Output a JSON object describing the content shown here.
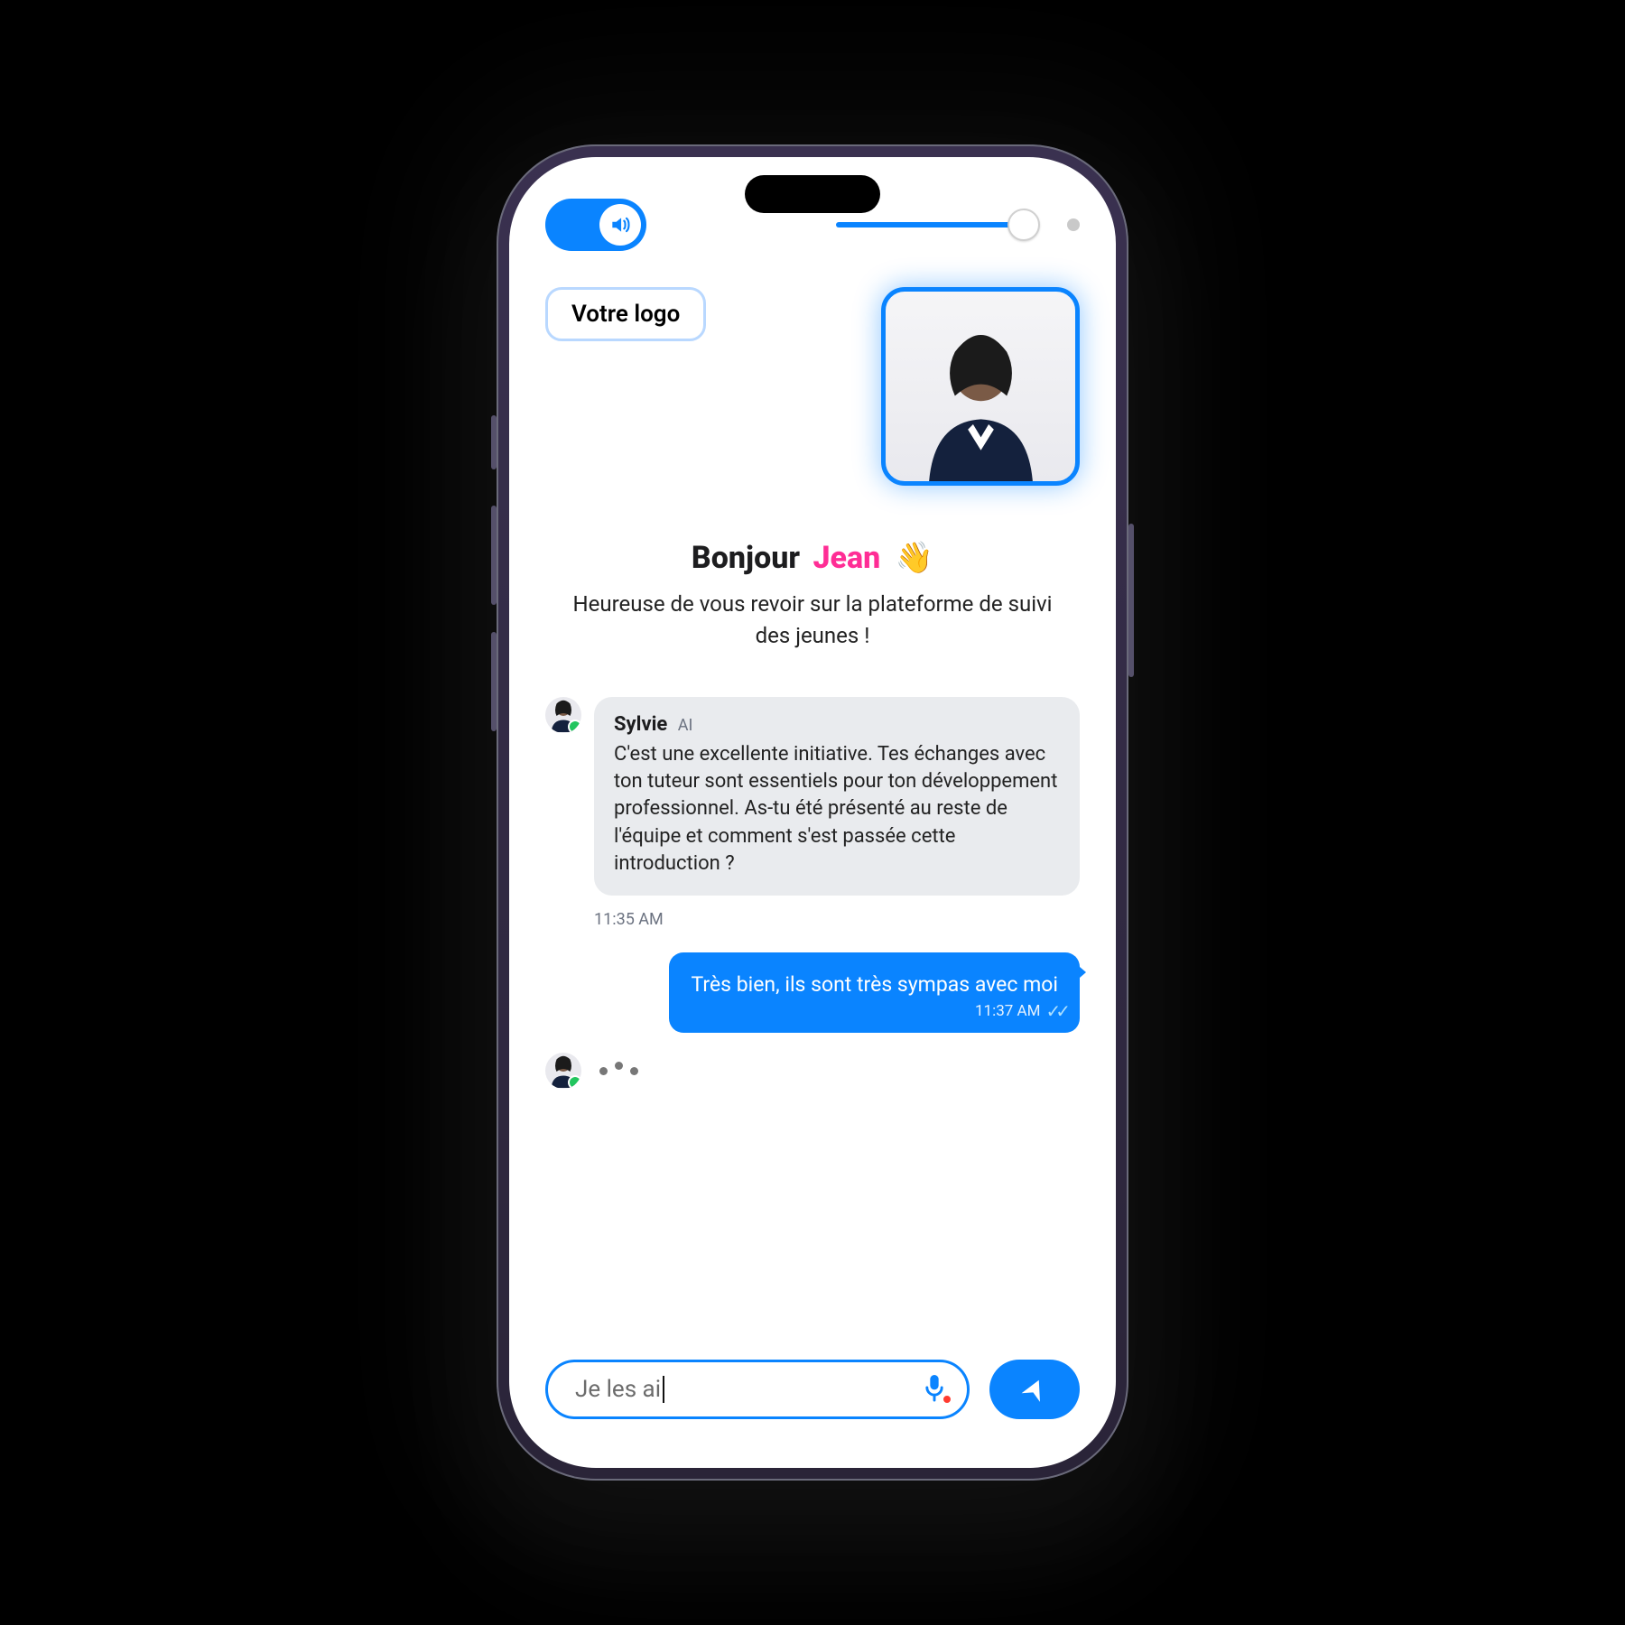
{
  "header": {
    "sound_on": true,
    "logo_label": "Votre logo"
  },
  "greeting": {
    "hello": "Bonjour",
    "name": "Jean",
    "wave_emoji": "👋",
    "subtitle": "Heureuse de vous revoir sur la plateforme de suivi des jeunes !"
  },
  "messages": {
    "ai": {
      "sender": "Sylvie",
      "tag": "AI",
      "body": "C'est une excellente initiative. Tes échanges avec ton tuteur sont essentiels pour ton développement professionnel. As-tu été présenté au reste de l'équipe et comment s'est passée cette introduction ?",
      "time": "11:35 AM"
    },
    "user": {
      "body": "Très bien, ils sont très sympas avec moi",
      "time": "11:37 AM"
    }
  },
  "composer": {
    "value": "Je les ai",
    "mic_recording": true
  },
  "colors": {
    "accent": "#0a84ff",
    "name": "#ff2d95"
  }
}
